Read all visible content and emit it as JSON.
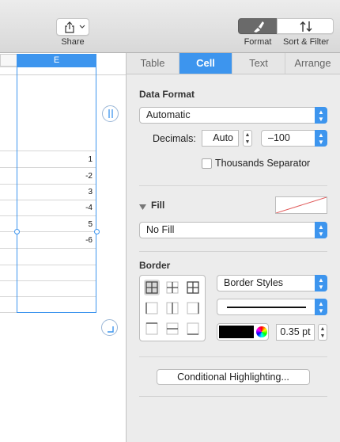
{
  "toolbar": {
    "share_label": "Share",
    "format_label": "Format",
    "sort_filter_label": "Sort & Filter"
  },
  "sheet": {
    "column_header": "E",
    "cells": [
      "1",
      "-2",
      "3",
      "-4",
      "5",
      "-6"
    ]
  },
  "inspector": {
    "tabs": [
      {
        "label": "Table",
        "active": false
      },
      {
        "label": "Cell",
        "active": true
      },
      {
        "label": "Text",
        "active": false
      },
      {
        "label": "Arrange",
        "active": false
      }
    ],
    "data_format": {
      "title": "Data Format",
      "format_value": "Automatic",
      "decimals_label": "Decimals:",
      "decimals_value": "Auto",
      "negative_format": "–100",
      "thousands_label": "Thousands Separator",
      "thousands_checked": false
    },
    "fill": {
      "title": "Fill",
      "value": "No Fill"
    },
    "border": {
      "title": "Border",
      "styles_value": "Border Styles",
      "width_value": "0.35 pt",
      "color": "#000000"
    },
    "conditional_button": "Conditional Highlighting..."
  },
  "colors": {
    "accent": "#3d95ee"
  }
}
